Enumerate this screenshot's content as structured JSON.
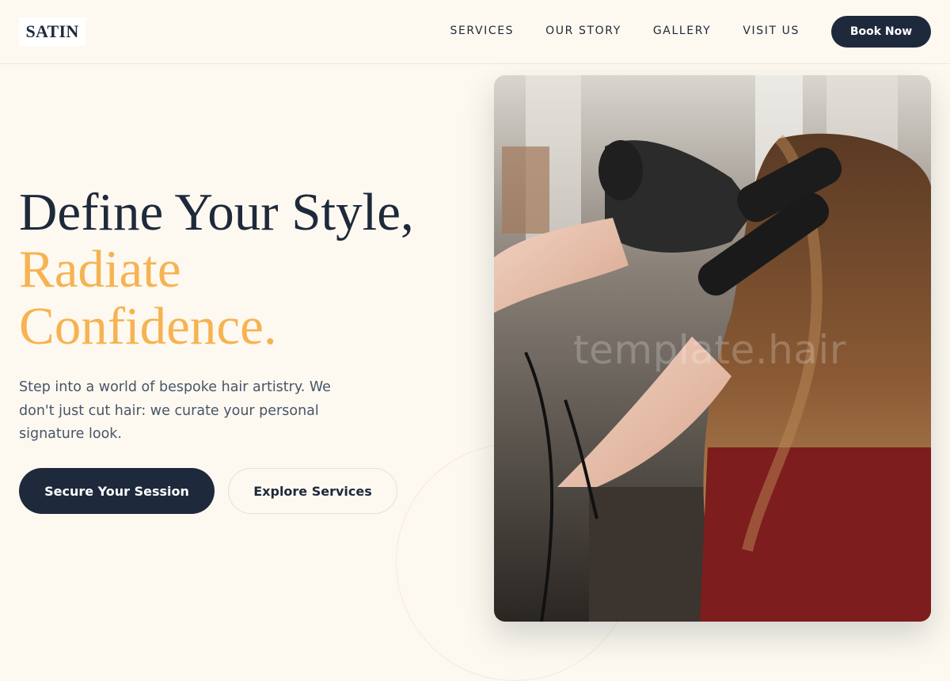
{
  "brand": {
    "logo_text": "SATIN"
  },
  "nav": {
    "links": [
      "SERVICES",
      "OUR STORY",
      "GALLERY",
      "VISIT US"
    ],
    "book_label": "Book Now"
  },
  "hero": {
    "title_line1": "Define Your Style,",
    "title_line2": "Radiate",
    "title_line3": "Confidence.",
    "description": "Step into a world of bespoke hair artistry. We don't just cut hair: we curate your personal signature look.",
    "primary_cta": "Secure Your Session",
    "secondary_cta": "Explore Services",
    "image_watermark": "template.hair"
  },
  "colors": {
    "background": "#fdf9f0",
    "navy": "#1e293b",
    "accent": "#f6b352",
    "body_text": "#475569"
  }
}
